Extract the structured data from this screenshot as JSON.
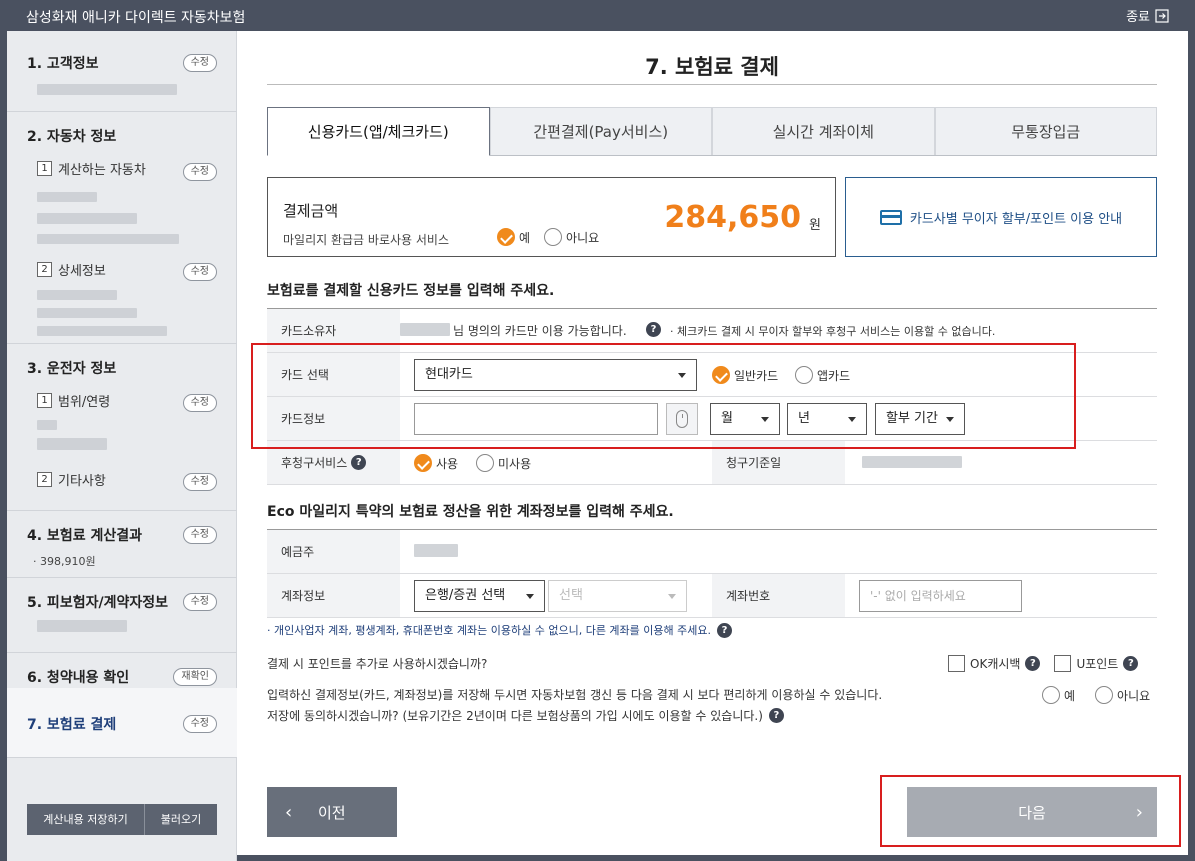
{
  "app": {
    "title": "삼성화재 애니카 다이렉트 자동차보험",
    "close_label": "종료"
  },
  "sidebar": {
    "sections": [
      {
        "title": "1. 고객정보",
        "edit": "수정"
      },
      {
        "title": "2. 자동차 정보",
        "sub": [
          {
            "num": "1",
            "label": "계산하는 자동차",
            "edit": "수정"
          },
          {
            "num": "2",
            "label": "상세정보",
            "edit": "수정"
          }
        ]
      },
      {
        "title": "3. 운전자 정보",
        "sub": [
          {
            "num": "1",
            "label": "범위/연령",
            "edit": "수정"
          },
          {
            "num": "2",
            "label": "기타사항",
            "edit": "수정"
          }
        ]
      },
      {
        "title": "4. 보험료 계산결과",
        "edit": "수정",
        "detail": "· 398,910원"
      },
      {
        "title": "5. 피보험자/계약자정보",
        "edit": "수정"
      },
      {
        "title": "6. 청약내용 확인",
        "edit": "재확인"
      },
      {
        "title": "7. 보험료 결제",
        "edit": "수정"
      }
    ],
    "save_label": "계산내용 저장하기",
    "load_label": "불러오기"
  },
  "page": {
    "title": "7. 보험료 결제"
  },
  "tabs": [
    {
      "label": "신용카드(앱/체크카드)",
      "active": true
    },
    {
      "label": "간편결제(Pay서비스)"
    },
    {
      "label": "실시간 계좌이체"
    },
    {
      "label": "무통장입금"
    }
  ],
  "payment": {
    "label": "결제금액",
    "amount": "284,650",
    "unit": "원",
    "mileage_service": "마일리지 환급금 바로사용 서비스",
    "yes": "예",
    "no": "아니요",
    "guide_label": "카드사별 무이자 할부/포인트 이용 안내"
  },
  "card_section": {
    "heading": "보험료를 결제할 신용카드 정보를 입력해 주세요.",
    "owner_label": "카드소유자",
    "owner_text": "님 명의의 카드만 이용 가능합니다.",
    "owner_note": "· 체크카드 결제 시 무이자 할부와 후청구 서비스는 이용할 수 없습니다.",
    "select_label": "카드 선택",
    "card_value": "현대카드",
    "card_type_general": "일반카드",
    "card_type_app": "앱카드",
    "info_label": "카드정보",
    "month": "월",
    "year": "년",
    "installment": "할부 기간",
    "postpay_label": "후청구서비스",
    "use": "사용",
    "no_use": "미사용",
    "billing_label": "청구기준일"
  },
  "eco_section": {
    "heading": "Eco 마일리지 특약의 보험료 정산을 위한 계좌정보를 입력해 주세요.",
    "depositor_label": "예금주",
    "account_info_label": "계좌정보",
    "bank_select": "은행/증권 선택",
    "sub_select": "선택",
    "account_no_label": "계좌번호",
    "account_placeholder": "'-' 없이 입력하세요",
    "note": "· 개인사업자 계좌, 평생계좌, 휴대폰번호 계좌는 이용하실 수 없으니, 다른 계좌를 이용해 주세요."
  },
  "points": {
    "question": "결제 시 포인트를 추가로 사용하시겠습니까?",
    "ok_cashbag": "OK캐시백",
    "u_point": "U포인트"
  },
  "save_info": {
    "line1": "입력하신 결제정보(카드, 계좌정보)를 저장해 두시면 자동차보험 갱신 등 다음 결제 시 보다 편리하게 이용하실 수 있습니다.",
    "line2": "저장에 동의하시겠습니까? (보유기간은 2년이며 다른 보험상품의 가입 시에도 이용할 수 있습니다.)",
    "yes": "예",
    "no": "아니요"
  },
  "nav": {
    "prev_label": "이전",
    "next_label": "다음"
  },
  "colors": {
    "accent_orange": "#f07f1a",
    "title_bar": "#4a5160",
    "highlight_red": "#d81e1e",
    "link_blue": "#1f4f86"
  }
}
